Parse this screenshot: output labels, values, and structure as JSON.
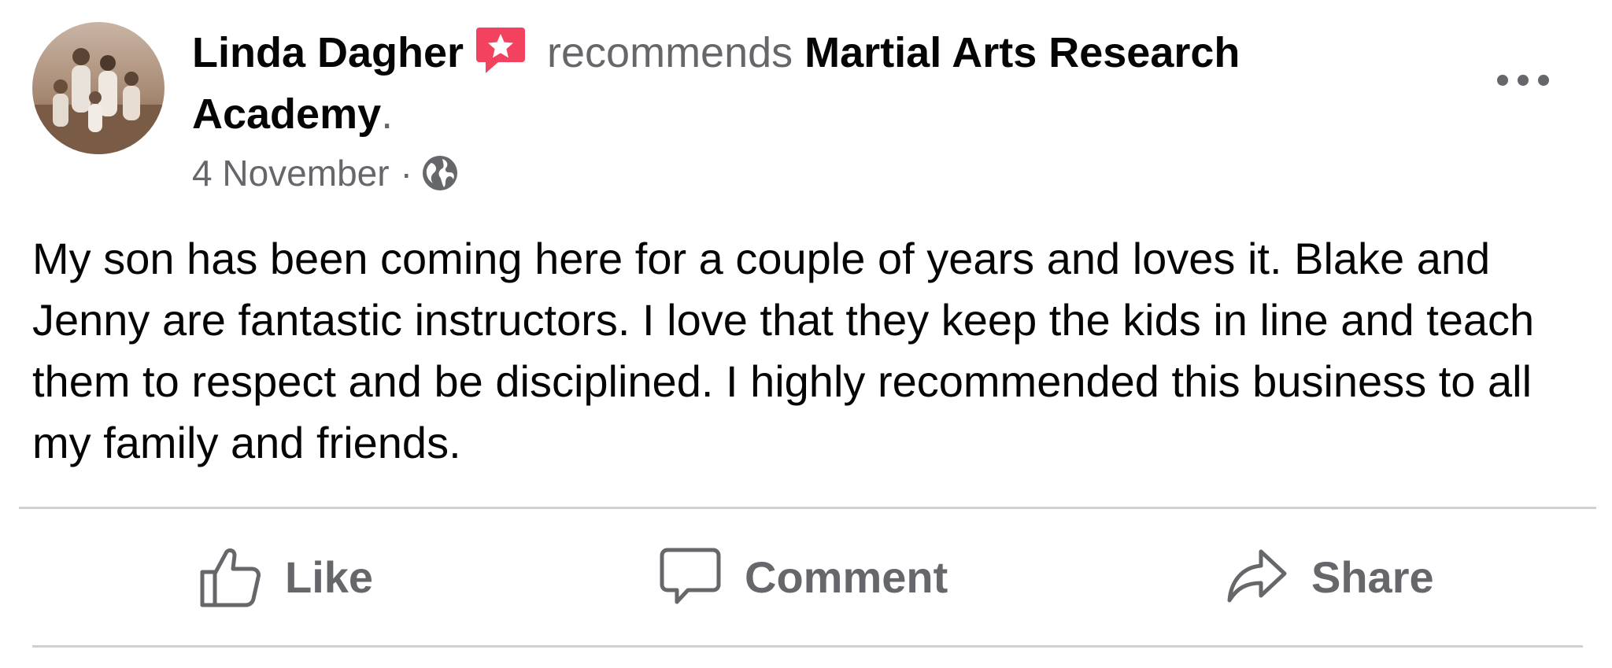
{
  "post": {
    "author": "Linda Dagher",
    "verb": "recommends",
    "page_name_line1": "Martial Arts Research",
    "page_name_line2": "Academy",
    "period": ".",
    "date": "4 November",
    "separator": "·",
    "audience_icon": "globe-icon",
    "recommend_icon": "recommendation-star-icon",
    "more_icon": "more-options-icon",
    "body": "My son has been coming here for a couple of years and loves it. Blake and Jenny are fantastic instructors. I love that they keep the kids in line and teach them to respect and be disciplined. I highly recommended this business to all my family and friends."
  },
  "actions": {
    "like_label": "Like",
    "like_icon": "thumbs-up-icon",
    "comment_label": "Comment",
    "comment_icon": "speech-bubble-icon",
    "share_label": "Share",
    "share_icon": "share-arrow-icon"
  },
  "colors": {
    "primary_text": "#050505",
    "secondary_text": "#65676b",
    "badge": "#f3425f",
    "divider": "#ced0d4"
  }
}
